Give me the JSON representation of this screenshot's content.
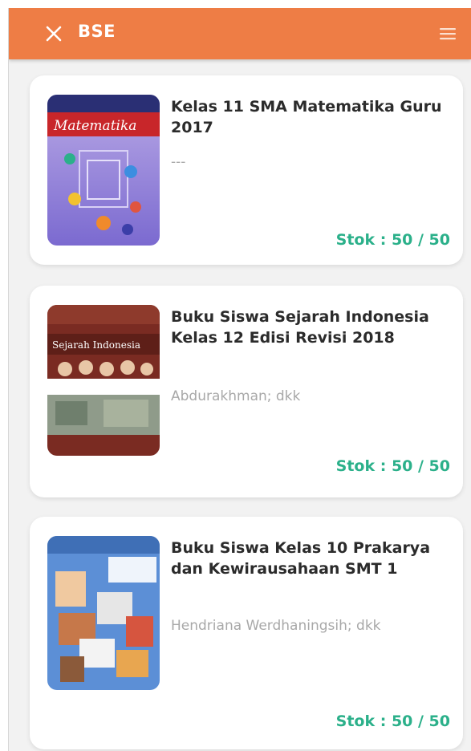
{
  "app": {
    "title": "BSE",
    "accent": "#ee7d45",
    "stock_color": "#2bb08a"
  },
  "books": [
    {
      "title": "Kelas 11 SMA Matematika Guru 2017",
      "author": "---",
      "stock": "Stok : 50 / 50",
      "cover_text": "Matematika"
    },
    {
      "title": "Buku Siswa Sejarah Indonesia Kelas 12 Edisi Revisi 2018",
      "author": "Abdurakhman; dkk",
      "stock": "Stok : 50 / 50",
      "cover_text": "Sejarah Indonesia"
    },
    {
      "title": "Buku Siswa Kelas 10 Prakarya dan Kewirausahaan SMT 1",
      "author": "Hendriana Werdhaningsih; dkk",
      "stock": "Stok : 50 / 50"
    }
  ]
}
